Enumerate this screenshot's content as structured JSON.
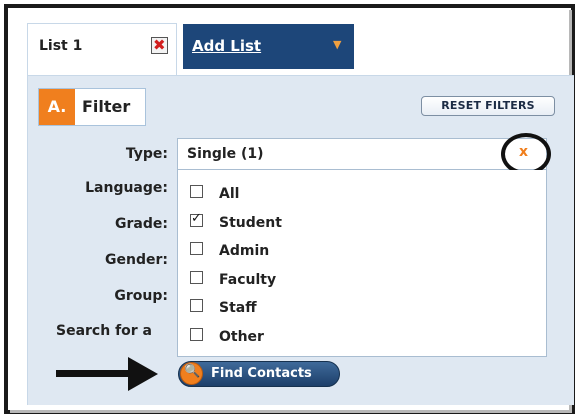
{
  "tabs": {
    "list1_label": "List 1",
    "add_list_label": "Add List"
  },
  "filter": {
    "section_letter": "A.",
    "section_label": "Filter",
    "reset_label": "RESET FILTERS"
  },
  "fields": {
    "type_label": "Type:",
    "type_value": "Single (1)",
    "type_clear": "x",
    "language_label": "Language:",
    "grade_label": "Grade:",
    "gender_label": "Gender:",
    "group_label": "Group:",
    "search_label": "Search for a"
  },
  "type_options": [
    {
      "label": "All",
      "checked": false
    },
    {
      "label": "Student",
      "checked": true
    },
    {
      "label": "Admin",
      "checked": false
    },
    {
      "label": "Faculty",
      "checked": false
    },
    {
      "label": "Staff",
      "checked": false
    },
    {
      "label": "Other",
      "checked": false
    }
  ],
  "actions": {
    "find_label": "Find Contacts"
  },
  "colors": {
    "accent_orange": "#f07f1e",
    "nav_blue": "#1d4679",
    "panel_bg": "#dfe8f2"
  },
  "icons": [
    "close-icon",
    "caret-down-icon",
    "clear-icon",
    "checkbox-icon",
    "magnifier-icon",
    "arrow-icon"
  ]
}
